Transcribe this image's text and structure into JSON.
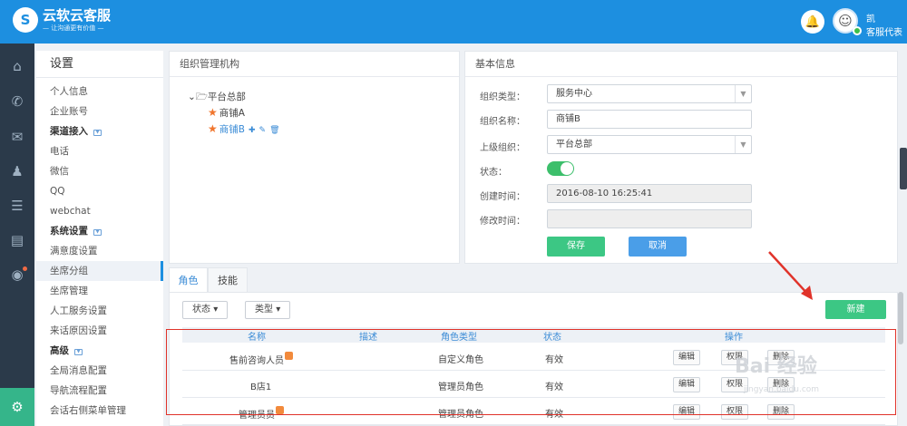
{
  "header": {
    "logo_mark": "S",
    "app_title": "云软云客服",
    "slogan": "— 让沟通更有价值 —",
    "bell_icon": "bell-icon",
    "user_name": "凯",
    "user_role": "客服代表"
  },
  "iconbar": [
    "home-icon",
    "phone-icon",
    "chat-icon",
    "users-icon",
    "list-icon",
    "chart-icon",
    "compass-icon",
    "settings-icon"
  ],
  "sidebar": {
    "title": "设置",
    "items": [
      {
        "label": "个人信息",
        "type": "item"
      },
      {
        "label": "企业账号",
        "type": "item"
      },
      {
        "label": "渠道接入",
        "type": "group"
      },
      {
        "label": "电话",
        "type": "item"
      },
      {
        "label": "微信",
        "type": "item"
      },
      {
        "label": "QQ",
        "type": "item"
      },
      {
        "label": "webchat",
        "type": "item"
      },
      {
        "label": "系统设置",
        "type": "group"
      },
      {
        "label": "满意度设置",
        "type": "item"
      },
      {
        "label": "坐席分组",
        "type": "item",
        "selected": true
      },
      {
        "label": "坐席管理",
        "type": "item"
      },
      {
        "label": "人工服务设置",
        "type": "item"
      },
      {
        "label": "来话原因设置",
        "type": "item"
      },
      {
        "label": "高级",
        "type": "group"
      },
      {
        "label": "全局消息配置",
        "type": "item"
      },
      {
        "label": "导航流程配置",
        "type": "item"
      },
      {
        "label": "会话右侧菜单管理",
        "type": "item"
      }
    ]
  },
  "org_panel": {
    "title": "组织管理机构",
    "root": "平台总部",
    "children": [
      "商铺A",
      "商铺B"
    ]
  },
  "info_panel": {
    "title": "基本信息",
    "type_label": "组织类型：",
    "type_value": "服务中心",
    "name_label": "组织名称：",
    "name_value": "商铺B",
    "parent_label": "上级组织：",
    "parent_value": "平台总部",
    "status_label": "状态：",
    "status_on": true,
    "created_label": "创建时间：",
    "created_value": "2016-08-10 16:25:41",
    "modified_label": "修改时间：",
    "modified_value": "",
    "save_label": "保存",
    "cancel_label": "取消"
  },
  "tabs": [
    "角色",
    "技能"
  ],
  "filters": {
    "status_label": "状态",
    "type_label": "类型"
  },
  "new_button": "新建",
  "table": {
    "headers": [
      "名称",
      "描述",
      "角色类型",
      "状态",
      "操作"
    ],
    "rows": [
      {
        "name": "售前咨询人员",
        "desc": "",
        "role_type": "自定义角色",
        "status": "有效"
      },
      {
        "name": "B店1",
        "desc": "",
        "role_type": "管理员角色",
        "status": "有效"
      },
      {
        "name": "管理员员",
        "desc": "",
        "role_type": "管理员角色",
        "status": "有效"
      }
    ],
    "actions": [
      "编辑",
      "权限",
      "删除"
    ]
  },
  "watermark": {
    "text": "Bai 经验",
    "sub": "jingyan.baidu.com"
  }
}
